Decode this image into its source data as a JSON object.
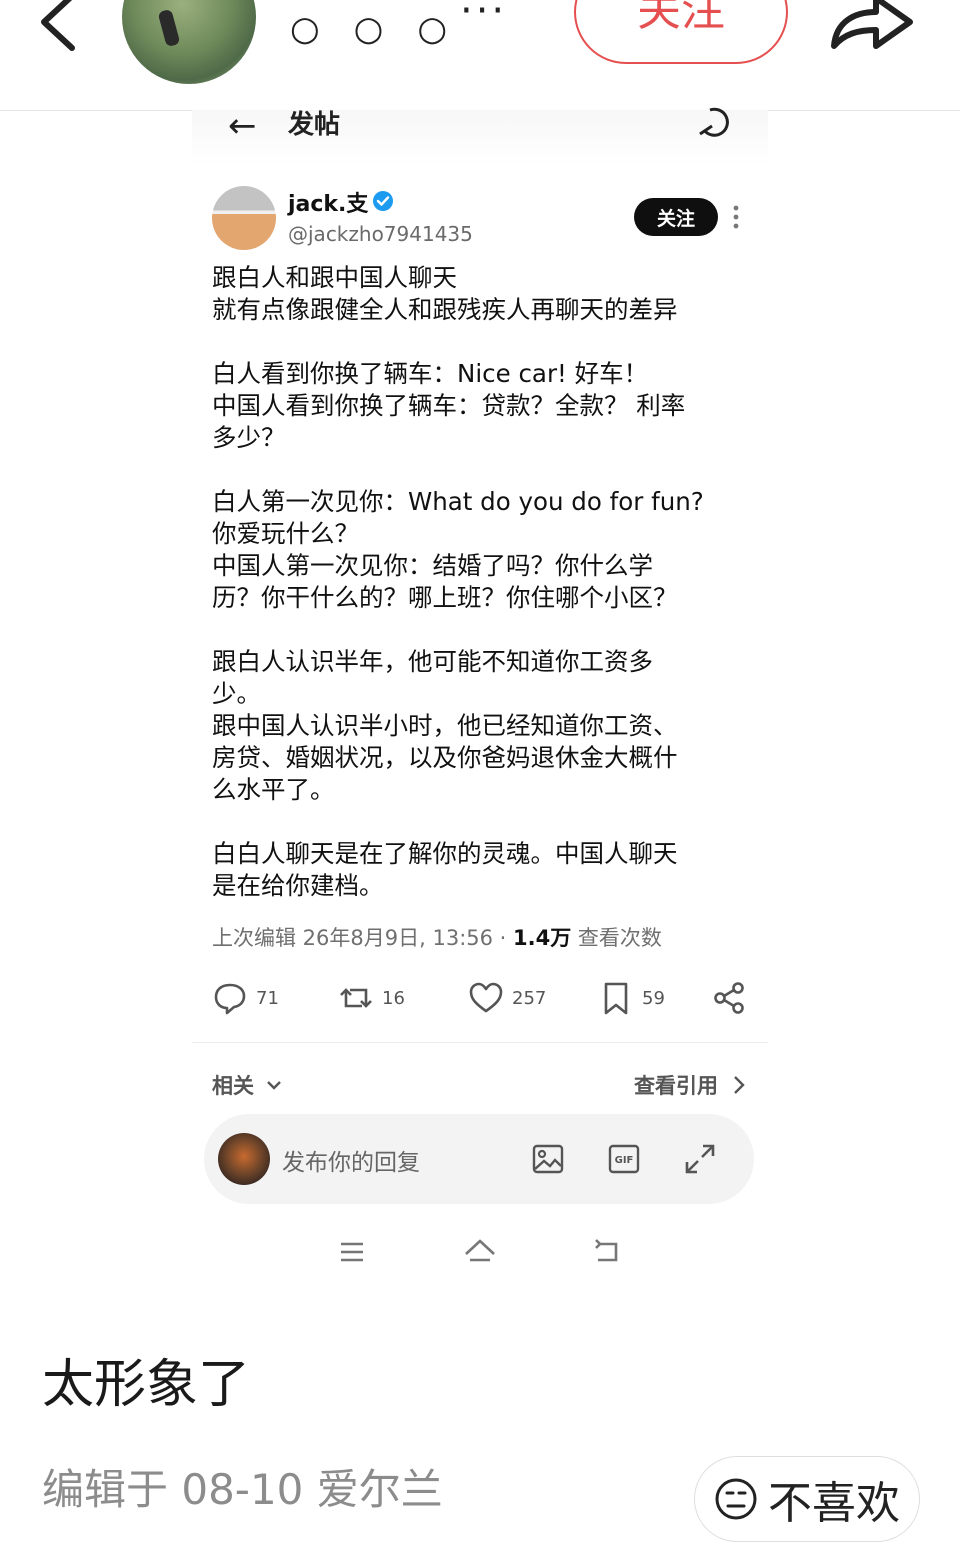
{
  "topbar": {
    "title_dots": [
      "○",
      "○",
      "○"
    ],
    "more_label": "···",
    "follow_label": "关注"
  },
  "embedded": {
    "header_back": "←",
    "header_title": "发帖",
    "user": {
      "name": "jack.支",
      "handle": "@jackzho7941435",
      "follow_label": "关注"
    },
    "body": [
      "跟白人和跟中国人聊天\n就有点像跟健全人和跟残疾人再聊天的差异",
      "白人看到你换了辆车：Nice car! 好车！\n中国人看到你换了辆车：贷款？全款？ 利率\n多少？",
      "白人第一次见你：What do you do for fun?\n你爱玩什么？\n中国人第一次见你：结婚了吗？你什么学\n历？你干什么的？哪上班？你住哪个小区？",
      "跟白人认识半年，他可能不知道你工资多\n少。\n跟中国人认识半小时，他已经知道你工资、\n房贷、婚姻状况，以及你爸妈退休金大概什\n么水平了。",
      "白白人聊天是在了解你的灵魂。中国人聊天\n是在给你建档。"
    ],
    "meta": {
      "edited": "上次编辑 26年8月9日, 13:56 · ",
      "views_count": "1.4万",
      "views_label": " 查看次数"
    },
    "actions": {
      "replies": "71",
      "retweets": "16",
      "likes": "257",
      "bookmarks": "59"
    },
    "related_label": "相关",
    "quotes_label": "查看引用",
    "reply_placeholder": "发布你的回复",
    "reply_icons": [
      "image-icon",
      "gif-icon",
      "expand-icon"
    ],
    "nav_icons": [
      "menu-icon",
      "home-icon",
      "back-icon"
    ]
  },
  "post": {
    "text": "太形象了",
    "meta": "编辑于 08-10 爱尔兰",
    "dislike_label": "不喜欢"
  },
  "colors": {
    "accent_red": "#e64f4f",
    "verified_blue": "#1d9bf0"
  }
}
